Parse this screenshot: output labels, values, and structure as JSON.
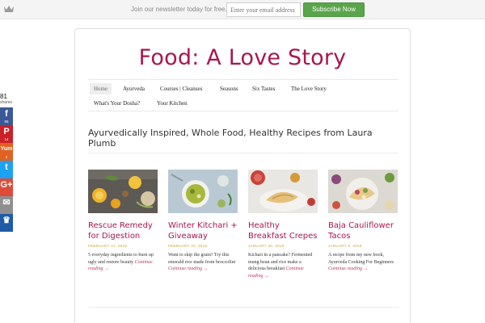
{
  "newsletter": {
    "text": "Join our newsletter today for free.",
    "email_placeholder": "Enter your email address",
    "button_label": "Subscribe Now"
  },
  "share": {
    "count": "81",
    "count_label": "shares",
    "buttons": [
      {
        "network": "facebook",
        "glyph": "f",
        "count": "65",
        "color": "#3b5998"
      },
      {
        "network": "pinterest",
        "glyph": "P",
        "count": "14",
        "color": "#cb2027"
      },
      {
        "network": "yummly",
        "glyph": "Yum",
        "count": "2",
        "color": "#e16120"
      },
      {
        "network": "twitter",
        "glyph": "t",
        "count": "",
        "color": "#1da1f2"
      },
      {
        "network": "google-plus",
        "glyph": "G+",
        "count": "",
        "color": "#dd4b39"
      },
      {
        "network": "email",
        "glyph": "✉",
        "count": "",
        "color": "#8f8f8f"
      },
      {
        "network": "sumo",
        "glyph": "♛",
        "count": "",
        "color": "#1e5ba8"
      }
    ]
  },
  "site": {
    "title": "Food: A Love Story",
    "tagline": "Ayurvedically Inspired, Whole Food, Healthy Recipes from Laura Plumb"
  },
  "nav": {
    "items": [
      "Home",
      "Ayurveda",
      "Courses | Cleanses",
      "Seasons",
      "Six Tastes",
      "The Love Story",
      "What's Your Dosha?",
      "Your Kitchen"
    ],
    "active": "Home"
  },
  "posts": [
    {
      "title": "Rescue Remedy for Digestion",
      "date": "FEBRUARY 21, 2018",
      "excerpt": "5 everyday ingredients to burn up ugly and restore beauty",
      "more": "Continue reading →"
    },
    {
      "title": "Winter Kitchari + Giveaway",
      "date": "FEBRUARY 20, 2018",
      "excerpt": "Want to skip the grain? Try this emerald rice made from broccolini",
      "more": "Continue reading →"
    },
    {
      "title": "Healthy Breakfast Crepes",
      "date": "JANUARY 30, 2018",
      "excerpt": "Kichari in a pancake? Fermented mung bean and rice make a delicious breakfast",
      "more": "Continue reading →"
    },
    {
      "title": "Baja Cauliflower Tacos",
      "date": "JANUARY 9, 2018",
      "excerpt": "A recipe from my new book, Ayurveda Cooking For Beginners",
      "more": "Continue reading →"
    }
  ],
  "colors": {
    "brand": "#a8174e",
    "subscribe": "#5aa44b",
    "date": "#c7a33b"
  }
}
